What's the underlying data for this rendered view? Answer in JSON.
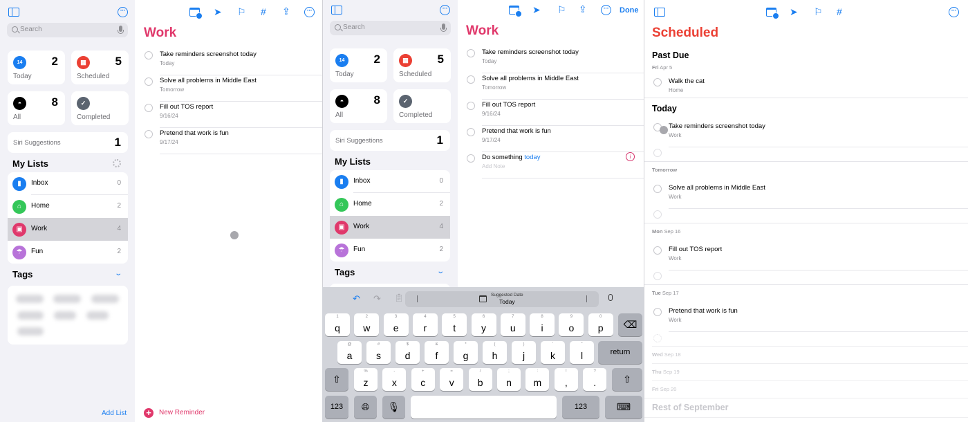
{
  "screens": [
    {
      "sidebar": {
        "search_placeholder": "Search",
        "smart_lists": [
          {
            "label": "Today",
            "count": "2",
            "icon": "calendar-today-icon",
            "glyph": "14",
            "color": "#1a7ef0"
          },
          {
            "label": "Scheduled",
            "count": "5",
            "icon": "calendar-scheduled-icon",
            "glyph": "▦",
            "color": "#eb4034"
          },
          {
            "label": "All",
            "count": "8",
            "icon": "tray-icon",
            "glyph": "◓",
            "color": "#000000"
          },
          {
            "label": "Completed",
            "count": "",
            "icon": "checkmark-icon",
            "glyph": "✓",
            "color": "#5b6470"
          }
        ],
        "siri_suggestions": {
          "label": "Siri Suggestions",
          "count": "1"
        },
        "my_lists_heading": "My Lists",
        "lists": [
          {
            "name": "Inbox",
            "count": "0",
            "icon": "bookmark-icon",
            "glyph": "▮",
            "color": "#1a7ef0"
          },
          {
            "name": "Home",
            "count": "2",
            "icon": "house-icon",
            "glyph": "⌂",
            "color": "#34c759"
          },
          {
            "name": "Work",
            "count": "4",
            "icon": "desktop-icon",
            "glyph": "▣",
            "color": "#e0386b",
            "selected": true
          },
          {
            "name": "Fun",
            "count": "2",
            "icon": "umbrella-icon",
            "glyph": "☂",
            "color": "#b873d9"
          }
        ],
        "tags_heading": "Tags",
        "add_list": "Add List"
      },
      "detail": {
        "title": "Work",
        "title_color": "#e0386b",
        "reminders": [
          {
            "title": "Take reminders screenshot today",
            "subtitle": "Today"
          },
          {
            "title": "Solve all problems in Middle East",
            "subtitle": "Tomorrow"
          },
          {
            "title": "Fill out TOS report",
            "subtitle": "9/16/24"
          },
          {
            "title": "Pretend that work is fun",
            "subtitle": "9/17/24"
          }
        ],
        "new_reminder": "New Reminder"
      }
    },
    {
      "sidebar": {
        "search_placeholder": "Search",
        "smart_lists": [
          {
            "label": "Today",
            "count": "2"
          },
          {
            "label": "Scheduled",
            "count": "5"
          },
          {
            "label": "All",
            "count": "8"
          },
          {
            "label": "Completed",
            "count": ""
          }
        ],
        "siri_suggestions": {
          "label": "Siri Suggestions",
          "count": "1"
        },
        "my_lists_heading": "My Lists",
        "lists": [
          {
            "name": "Inbox",
            "count": "0"
          },
          {
            "name": "Home",
            "count": "2"
          },
          {
            "name": "Work",
            "count": "4",
            "selected": true
          },
          {
            "name": "Fun",
            "count": "2"
          }
        ],
        "tags_heading": "Tags"
      },
      "detail": {
        "title": "Work",
        "done": "Done",
        "reminders": [
          {
            "title": "Take reminders screenshot today",
            "subtitle": "Today"
          },
          {
            "title": "Solve all problems in Middle East",
            "subtitle": "Tomorrow"
          },
          {
            "title": "Fill out TOS report",
            "subtitle": "9/16/24"
          },
          {
            "title": "Pretend that work is fun",
            "subtitle": "9/17/24"
          }
        ],
        "editing": {
          "title_prefix": "Do something ",
          "title_highlight": "today",
          "note_placeholder": "Add Note"
        }
      },
      "keyboard": {
        "suggestion_caption": "Suggested Date",
        "suggestion_value": "Today",
        "row1": [
          [
            "1",
            "q"
          ],
          [
            "2",
            "w"
          ],
          [
            "3",
            "e"
          ],
          [
            "4",
            "r"
          ],
          [
            "5",
            "t"
          ],
          [
            "6",
            "y"
          ],
          [
            "7",
            "u"
          ],
          [
            "8",
            "i"
          ],
          [
            "9",
            "o"
          ],
          [
            "0",
            "p"
          ]
        ],
        "row2": [
          [
            "@",
            "a"
          ],
          [
            "#",
            "s"
          ],
          [
            "$",
            "d"
          ],
          [
            "&",
            "f"
          ],
          [
            "*",
            "g"
          ],
          [
            "(",
            "h"
          ],
          [
            ")",
            "j"
          ],
          [
            "'",
            "k"
          ],
          [
            "\"",
            "l"
          ]
        ],
        "row3": [
          [
            "%",
            "z"
          ],
          [
            "-",
            "x"
          ],
          [
            "+",
            "c"
          ],
          [
            "=",
            "v"
          ],
          [
            "/",
            "b"
          ],
          [
            ";",
            "n"
          ],
          [
            ":",
            "m"
          ],
          [
            "!",
            ","
          ],
          [
            "?",
            "."
          ]
        ],
        "return": "return",
        "numbers": "123"
      }
    },
    {
      "detail": {
        "title": "Scheduled",
        "title_color": "#eb4034",
        "past_due_heading": "Past Due",
        "today_heading": "Today",
        "rest_heading": "Rest of September",
        "groups": [
          {
            "day": "Fri",
            "date": "Apr 5",
            "items": [
              {
                "title": "Walk the cat",
                "list": "Home"
              }
            ]
          },
          {
            "items": [
              {
                "title": "Take reminders screenshot today",
                "list": "Work"
              }
            ]
          },
          {
            "label": "Tomorrow",
            "items": [
              {
                "title": "Solve all problems in Middle East",
                "list": "Work"
              }
            ]
          },
          {
            "day": "Mon",
            "date": "Sep 16",
            "items": [
              {
                "title": "Fill out TOS report",
                "list": "Work"
              }
            ]
          },
          {
            "day": "Tue",
            "date": "Sep 17",
            "items": [
              {
                "title": "Pretend that work is fun",
                "list": "Work"
              }
            ]
          },
          {
            "day": "Wed",
            "date": "Sep 18",
            "items": []
          },
          {
            "day": "Thu",
            "date": "Sep 19",
            "items": []
          },
          {
            "day": "Fri",
            "date": "Sep 20",
            "items": []
          }
        ]
      }
    }
  ]
}
